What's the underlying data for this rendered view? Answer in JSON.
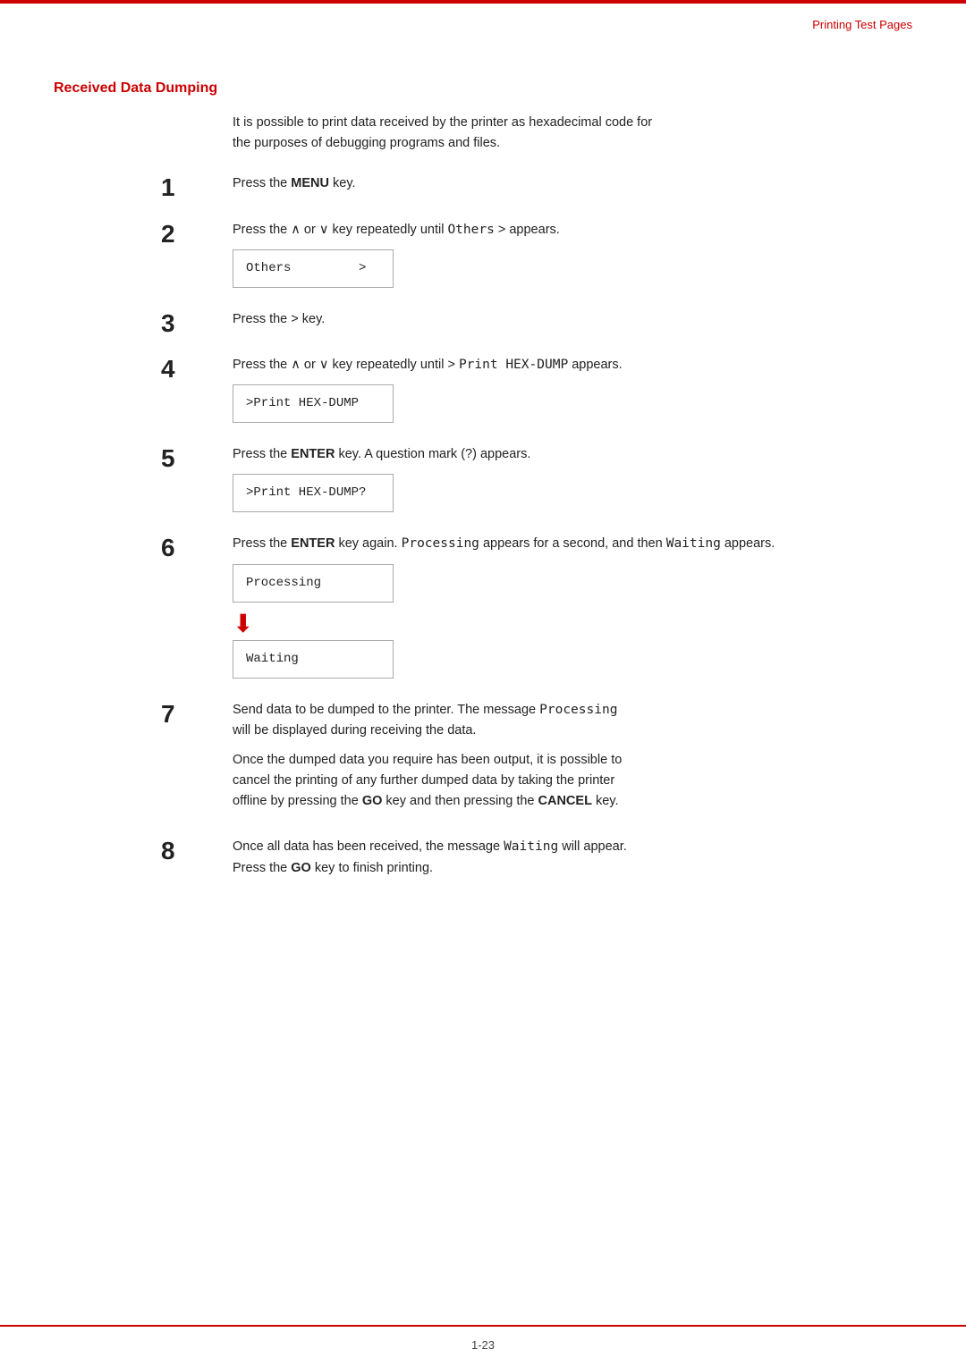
{
  "header": {
    "top_line": true,
    "right_label": "Printing Test Pages"
  },
  "footer": {
    "page_number": "1-23"
  },
  "section": {
    "title": "Received Data Dumping",
    "intro": "It is possible to print data received by the printer as hexadecimal code for\nthe purposes of debugging programs and files."
  },
  "steps": [
    {
      "number": "1",
      "text_parts": [
        {
          "type": "plain",
          "text": "Press the "
        },
        {
          "type": "bold",
          "text": "MENU"
        },
        {
          "type": "plain",
          "text": " key."
        }
      ],
      "box": null
    },
    {
      "number": "2",
      "text_parts": [
        {
          "type": "plain",
          "text": "Press the ∧ or ∨ key repeatedly until "
        },
        {
          "type": "mono",
          "text": "Others"
        },
        {
          "type": "plain",
          "text": " > appears."
        }
      ],
      "box": "Others          >"
    },
    {
      "number": "3",
      "text_parts": [
        {
          "type": "plain",
          "text": "Press the > key."
        }
      ],
      "box": null
    },
    {
      "number": "4",
      "text_parts": [
        {
          "type": "plain",
          "text": "Press the ∧ or ∨ key repeatedly until > "
        },
        {
          "type": "mono",
          "text": "Print HEX-DUMP"
        },
        {
          "type": "plain",
          "text": " appears."
        }
      ],
      "box": ">Print HEX-DUMP"
    },
    {
      "number": "5",
      "text_parts": [
        {
          "type": "plain",
          "text": "Press the "
        },
        {
          "type": "bold",
          "text": "ENTER"
        },
        {
          "type": "plain",
          "text": " key. A question mark (?) appears."
        }
      ],
      "box": ">Print HEX-DUMP?"
    },
    {
      "number": "6",
      "text_parts": [
        {
          "type": "plain",
          "text": "Press the "
        },
        {
          "type": "bold",
          "text": "ENTER"
        },
        {
          "type": "plain",
          "text": " key again. "
        },
        {
          "type": "mono",
          "text": "Processing"
        },
        {
          "type": "plain",
          "text": " appears for a second, and\nthen "
        },
        {
          "type": "mono",
          "text": "Waiting"
        },
        {
          "type": "plain",
          "text": " appears."
        }
      ],
      "box_processing": "Processing",
      "box_waiting": "Waiting"
    },
    {
      "number": "7",
      "text_parts": [
        {
          "type": "plain",
          "text": "Send data to be dumped to the printer. The message "
        },
        {
          "type": "mono",
          "text": "Processing"
        },
        {
          "type": "plain",
          "text": "\nwill be displayed during receiving the data."
        }
      ],
      "extra_text": "Once the dumped data you require has been output, it is possible to\ncancel the printing of any further dumped data by taking the printer\noffline by pressing the GO key and then pressing the CANCEL key.",
      "extra_bold": [
        "GO",
        "CANCEL"
      ],
      "box": null
    },
    {
      "number": "8",
      "text_parts": [
        {
          "type": "plain",
          "text": "Once all data has been received, the message "
        },
        {
          "type": "mono",
          "text": "Waiting"
        },
        {
          "type": "plain",
          "text": " will appear.\nPress the "
        },
        {
          "type": "bold",
          "text": "GO"
        },
        {
          "type": "plain",
          "text": " key to finish printing."
        }
      ],
      "box": null
    }
  ]
}
